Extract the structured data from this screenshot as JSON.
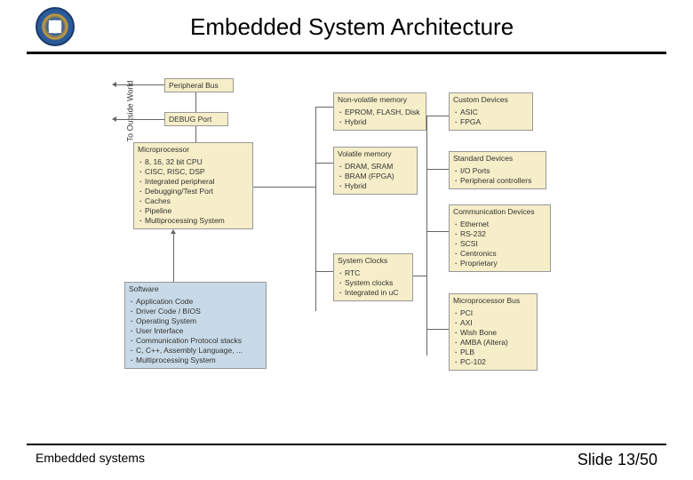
{
  "title": "Embedded System Architecture",
  "footer_left": "Embedded systems",
  "footer_right": "Slide 13/50",
  "vtext": "To Outside World",
  "boxes": {
    "pbus": {
      "title": "Peripheral Bus"
    },
    "debug": {
      "title": "DEBUG Port"
    },
    "micro": {
      "title": "Microprocessor",
      "items": [
        "8, 16, 32 bit CPU",
        "CISC, RISC, DSP",
        "Integrated peripheral",
        "Debugging/Test Port",
        "Caches",
        "Pipeline",
        "Multiprocessing System"
      ]
    },
    "soft": {
      "title": "Software",
      "items": [
        "Application Code",
        "Driver Code / BIOS",
        "Operating System",
        "User Interface",
        "Communication Protocol stacks",
        "C, C++, Assembly Language, ...",
        "Multiprocessing System"
      ]
    },
    "nvm": {
      "title": "Non-volatile memory",
      "items": [
        "EPROM, FLASH, Disk",
        "Hybrid"
      ]
    },
    "vm": {
      "title": "Volatile memory",
      "items": [
        "DRAM, SRAM",
        "BRAM (FPGA)",
        "Hybrid"
      ]
    },
    "clk": {
      "title": "System Clocks",
      "items": [
        "RTC",
        "System clocks",
        "Integrated in uC"
      ]
    },
    "cust": {
      "title": "Custom Devices",
      "items": [
        "ASIC",
        "FPGA"
      ]
    },
    "std": {
      "title": "Standard Devices",
      "items": [
        "I/O Ports",
        "Peripheral controllers"
      ]
    },
    "comm": {
      "title": "Communication Devices",
      "items": [
        "Ethernet",
        "RS-232",
        "SCSI",
        "Centronics",
        "Proprietary"
      ]
    },
    "mbus": {
      "title": "Microprocessor Bus",
      "items": [
        "PCI",
        "AXI",
        "Wish Bone",
        "AMBA (Altera)",
        "PLB",
        "PC-102"
      ]
    }
  }
}
